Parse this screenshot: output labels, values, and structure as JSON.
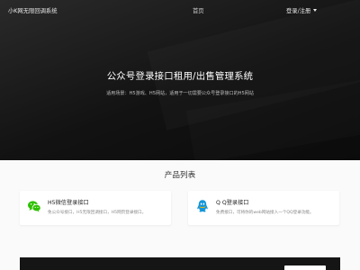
{
  "navbar": {
    "brand": "小K网无限回调系统",
    "home_label": "首页",
    "login_label": "登录/注册"
  },
  "hero": {
    "title": "公众号登录接口租用/出售管理系统",
    "subtitle": "适用场景：H5游戏、H5网站，适用于一切需要公众号登录接口的H5网站"
  },
  "products": {
    "section_title": "产品列表",
    "items": [
      {
        "title": "H5微信登录接口",
        "desc": "免公众号接口，H5无限回调接口，H5网页登录接口。",
        "icon": "wechat-icon",
        "icon_color": "#2dc100"
      },
      {
        "title": "Q Q登录接口",
        "desc": "免费接口，可将你的web网站接入一个QQ登录功能。",
        "icon": "qq-icon",
        "icon_color": "#1296db"
      }
    ]
  },
  "colors": {
    "hero_bg": "#151515",
    "page_bg": "#fafafa",
    "card_bg": "#ffffff"
  }
}
